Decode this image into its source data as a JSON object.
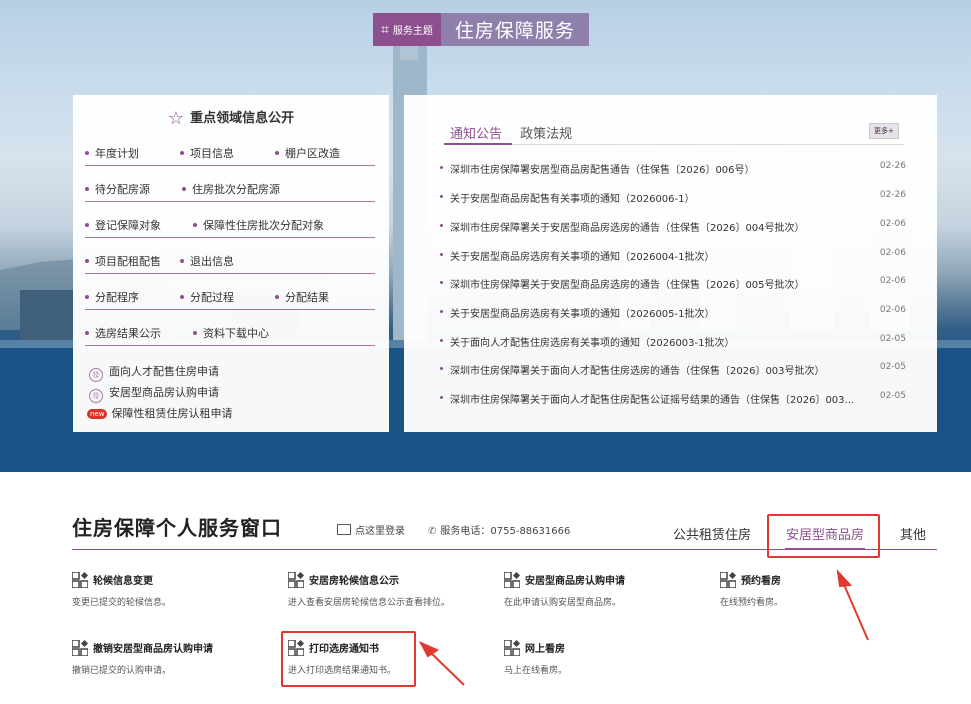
{
  "banner": {
    "tag_icon": "grid-icon",
    "tag": "服务主题",
    "title": "住房保障服务"
  },
  "left_panel": {
    "title": "重点领域信息公开",
    "rows": [
      [
        "年度计划",
        "项目信息",
        "棚户区改造"
      ],
      [
        "待分配房源",
        "住房批次分配房源"
      ],
      [
        "登记保障对象",
        "保障性住房批次分配对象"
      ],
      [
        "项目配租配售",
        "退出信息"
      ],
      [
        "分配程序",
        "分配过程",
        "分配结果"
      ],
      [
        "选房结果公示",
        "资料下载中心"
      ]
    ],
    "links": [
      {
        "badge": "⑫",
        "label": "面向人才配售住房申请"
      },
      {
        "badge": "⑫",
        "label": "安居型商品房认购申请"
      },
      {
        "badge": "new",
        "label": "保障性租赁住房认租申请"
      }
    ]
  },
  "right_panel": {
    "tabs": [
      "通知公告",
      "政策法规"
    ],
    "more": "更多+",
    "news": [
      {
        "title": "深圳市住房保障署安居型商品房配售通告（住保售〔2026〕006号）",
        "date": "02-26"
      },
      {
        "title": "关于安居型商品房配售有关事项的通知（2026006-1）",
        "date": "02-26"
      },
      {
        "title": "深圳市住房保障署关于安居型商品房选房的通告（住保售〔2026〕004号批次）",
        "date": "02-06"
      },
      {
        "title": "关于安居型商品房选房有关事项的通知（2026004-1批次）",
        "date": "02-06"
      },
      {
        "title": "深圳市住房保障署关于安居型商品房选房的通告（住保售〔2026〕005号批次）",
        "date": "02-06"
      },
      {
        "title": "关于安居型商品房选房有关事项的通知（2026005-1批次）",
        "date": "02-06"
      },
      {
        "title": "关于面向人才配售住房选房有关事项的通知（2026003-1批次）",
        "date": "02-05"
      },
      {
        "title": "深圳市住房保障署关于面向人才配售住房选房的通告（住保售〔2026〕003号批次）",
        "date": "02-05"
      },
      {
        "title": "深圳市住房保障署关于面向人才配售住房配售公证摇号结果的通告（住保售〔2026〕003...",
        "date": "02-05"
      }
    ]
  },
  "service": {
    "title": "住房保障个人服务窗口",
    "login": "点这里登录",
    "phone": "服务电话：0755-88631666",
    "categories": [
      "公共租赁住房",
      "安居型商品房",
      "其他"
    ],
    "items": [
      {
        "title": "轮候信息变更",
        "desc": "变更已提交的轮候信息。"
      },
      {
        "title": "安居房轮候信息公示",
        "desc": "进入查看安居房轮候信息公示查看排位。"
      },
      {
        "title": "安居型商品房认购申请",
        "desc": "在此申请认购安居型商品房。"
      },
      {
        "title": "预约看房",
        "desc": "在线预约看房。"
      },
      {
        "title": "撤销安居型商品房认购申请",
        "desc": "撤销已提交的认购申请。"
      },
      {
        "title": "打印选房通知书",
        "desc": "进入打印选房结果通知书。"
      },
      {
        "title": "网上看房",
        "desc": "马上在线看房。"
      }
    ]
  },
  "colors": {
    "accent": "#8d4f8f",
    "highlight": "#e03a30"
  }
}
